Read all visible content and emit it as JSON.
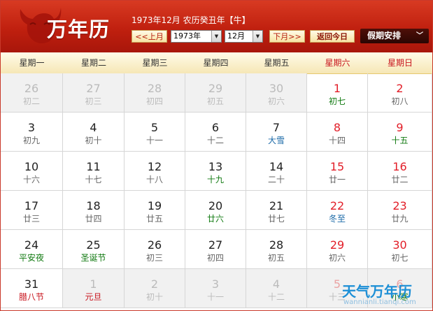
{
  "header": {
    "brand": "万年历",
    "date_text": "1973年12月 农历癸丑年【牛】",
    "prev_label": "<<上月",
    "next_label": "下月>>",
    "year_value": "1973年",
    "month_value": "12月",
    "today_label": "返回今日",
    "holiday_label": "假期安排"
  },
  "weekdays": [
    "星期一",
    "星期二",
    "星期三",
    "星期四",
    "星期五",
    "星期六",
    "星期日"
  ],
  "days": [
    {
      "d": "26",
      "l": "初二",
      "o": true
    },
    {
      "d": "27",
      "l": "初三",
      "o": true
    },
    {
      "d": "28",
      "l": "初四",
      "o": true
    },
    {
      "d": "29",
      "l": "初五",
      "o": true
    },
    {
      "d": "30",
      "l": "初六",
      "o": true
    },
    {
      "d": "1",
      "l": "初七",
      "c": "g"
    },
    {
      "d": "2",
      "l": "初八"
    },
    {
      "d": "3",
      "l": "初九"
    },
    {
      "d": "4",
      "l": "初十"
    },
    {
      "d": "5",
      "l": "十一"
    },
    {
      "d": "6",
      "l": "十二"
    },
    {
      "d": "7",
      "l": "大雪",
      "c": "b"
    },
    {
      "d": "8",
      "l": "十四"
    },
    {
      "d": "9",
      "l": "十五",
      "c": "g"
    },
    {
      "d": "10",
      "l": "十六"
    },
    {
      "d": "11",
      "l": "十七"
    },
    {
      "d": "12",
      "l": "十八"
    },
    {
      "d": "13",
      "l": "十九",
      "c": "g"
    },
    {
      "d": "14",
      "l": "二十"
    },
    {
      "d": "15",
      "l": "廿一"
    },
    {
      "d": "16",
      "l": "廿二"
    },
    {
      "d": "17",
      "l": "廿三"
    },
    {
      "d": "18",
      "l": "廿四"
    },
    {
      "d": "19",
      "l": "廿五"
    },
    {
      "d": "20",
      "l": "廿六",
      "c": "g"
    },
    {
      "d": "21",
      "l": "廿七"
    },
    {
      "d": "22",
      "l": "冬至",
      "c": "b"
    },
    {
      "d": "23",
      "l": "廿九"
    },
    {
      "d": "24",
      "l": "平安夜",
      "c": "g"
    },
    {
      "d": "25",
      "l": "圣诞节",
      "c": "g"
    },
    {
      "d": "26",
      "l": "初三"
    },
    {
      "d": "27",
      "l": "初四"
    },
    {
      "d": "28",
      "l": "初五"
    },
    {
      "d": "29",
      "l": "初六"
    },
    {
      "d": "30",
      "l": "初七"
    },
    {
      "d": "31",
      "l": "腊八节",
      "c": "r"
    },
    {
      "d": "1",
      "l": "元旦",
      "o": true,
      "c": "r"
    },
    {
      "d": "2",
      "l": "初十",
      "o": true
    },
    {
      "d": "3",
      "l": "十一",
      "o": true
    },
    {
      "d": "4",
      "l": "十二",
      "o": true
    },
    {
      "d": "5",
      "l": "十三",
      "o": true
    },
    {
      "d": "6",
      "l": "小寒",
      "o": true,
      "c": "g"
    }
  ],
  "watermark": {
    "text": "天气万年历",
    "url": "wannianli.tianqi.com"
  }
}
